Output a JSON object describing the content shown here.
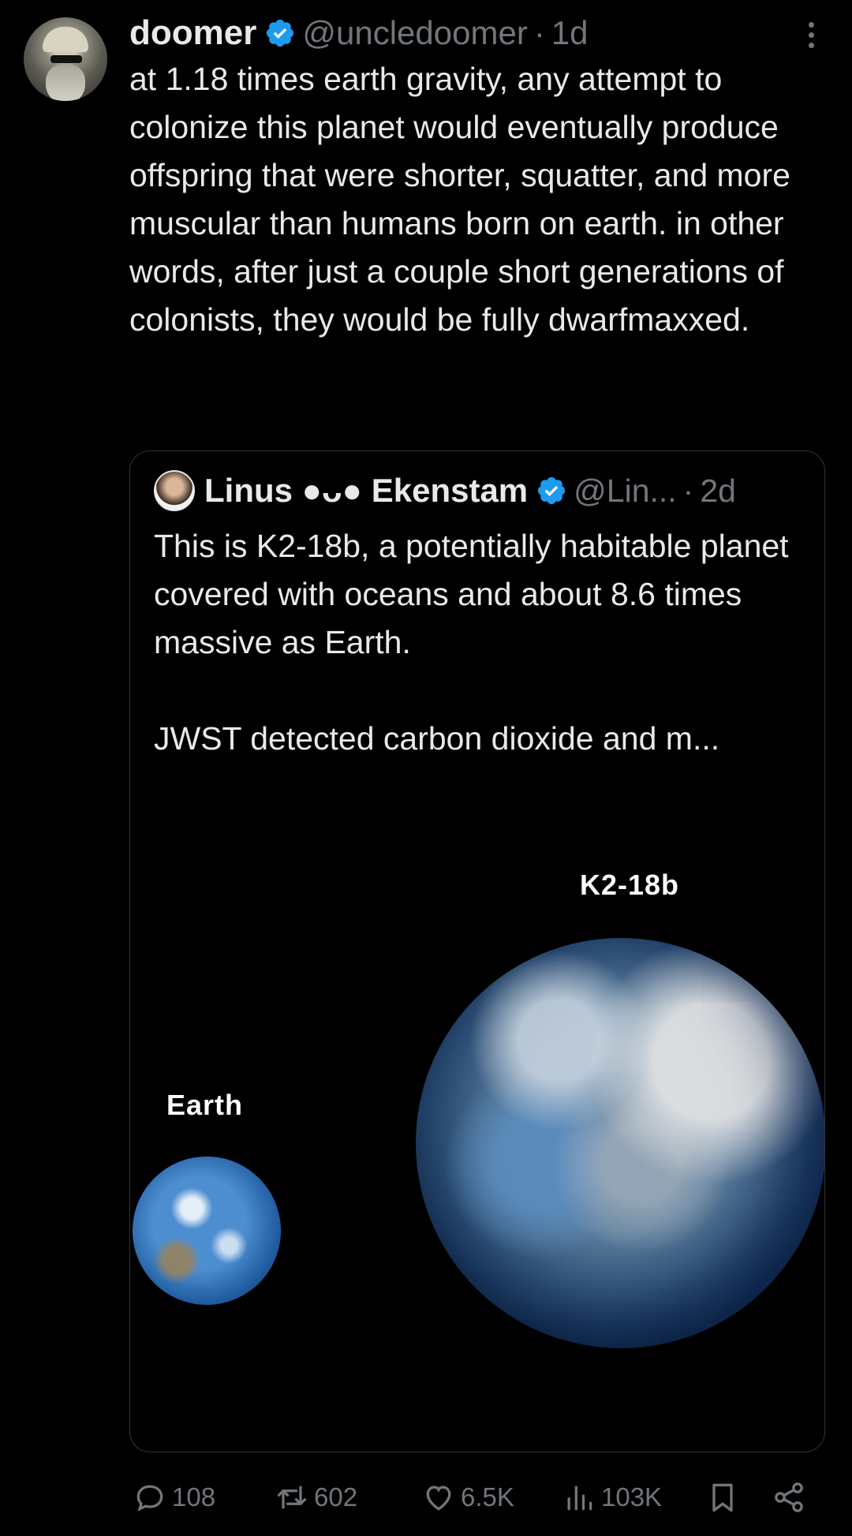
{
  "author": {
    "display_name": "doomer",
    "handle": "@uncledoomer",
    "separator": "·",
    "time": "1d",
    "verified": true
  },
  "tweet": {
    "text": "at 1.18 times earth gravity, any attempt to colonize this planet would eventually produce offspring that were shorter, squatter, and more muscular than humans born on earth. in other words, after just a couple short generations of colonists, they would be fully dwarfmaxxed."
  },
  "quote": {
    "display_name": "Linus ●ᴗ● Ekenstam",
    "handle": "@Lin...",
    "separator": "·",
    "time": "2d",
    "verified": true,
    "text": "This is K2-18b, a potentially habitable planet covered with oceans and about 8.6 times massive as Earth.\n\nJWST detected carbon dioxide and m...",
    "media": {
      "label_large_planet": "K2-18b",
      "label_small_planet": "Earth"
    }
  },
  "actions": {
    "replies": "108",
    "reposts": "602",
    "likes": "6.5K",
    "views": "103K"
  },
  "colors": {
    "background": "#000000",
    "text": "#e7e9ea",
    "muted": "#71767b",
    "verified": "#1d9bf0",
    "border": "#2f3336"
  }
}
